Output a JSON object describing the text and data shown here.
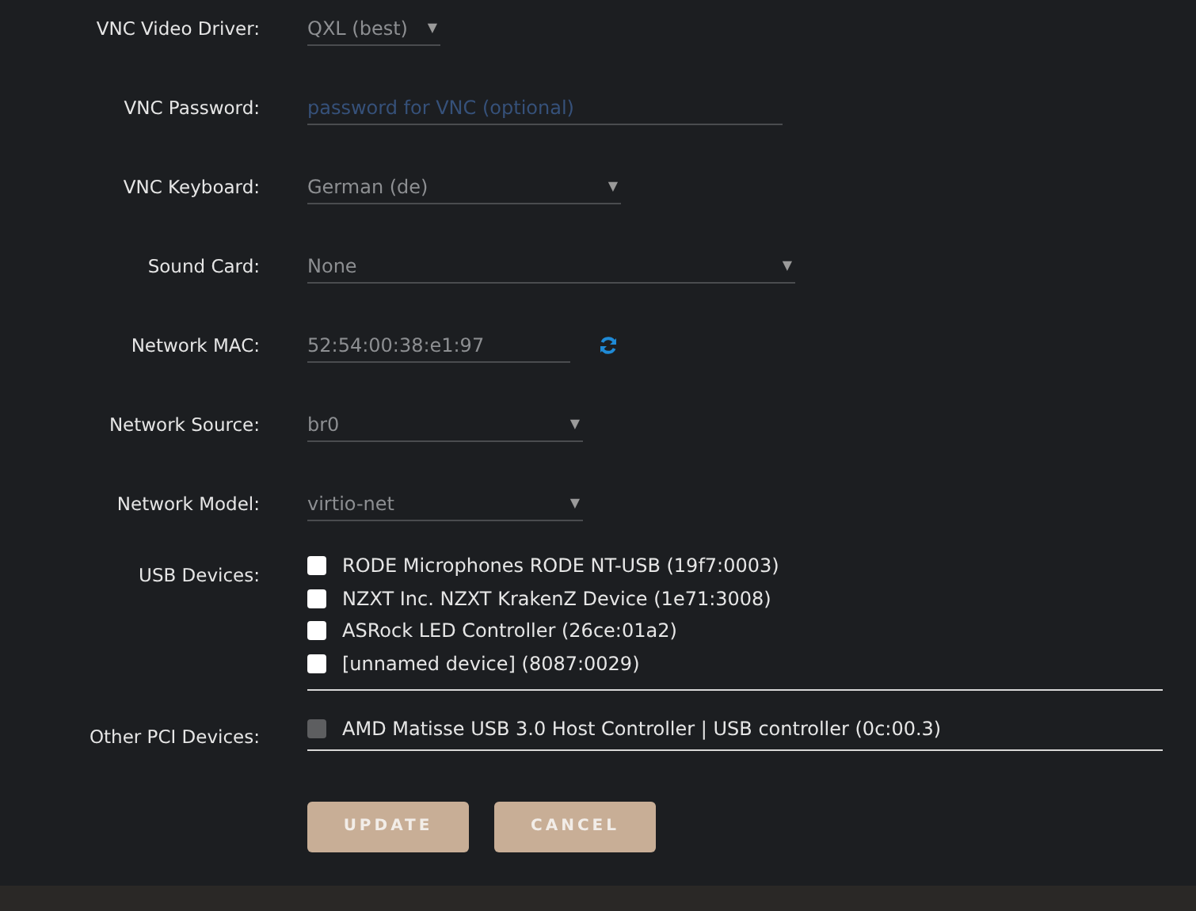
{
  "fields": [
    {
      "kind": "select",
      "label": "VNC Video Driver:",
      "value": "QXL (best)",
      "caret": "▼"
    },
    {
      "kind": "text",
      "label": "VNC Password:",
      "placeholder": "password for VNC (optional)"
    },
    {
      "kind": "select",
      "label": "VNC Keyboard:",
      "value": "German (de)",
      "caret": "▼"
    },
    {
      "kind": "select",
      "label": "Sound Card:",
      "value": "None",
      "caret": "▼"
    },
    {
      "kind": "mac",
      "label": "Network MAC:",
      "value": "52:54:00:38:e1:97"
    },
    {
      "kind": "select",
      "label": "Network Source:",
      "value": "br0",
      "caret": "▼"
    },
    {
      "kind": "select",
      "label": "Network Model:",
      "value": "virtio-net",
      "caret": "▼"
    }
  ],
  "usb": {
    "label": "USB Devices:",
    "items": [
      {
        "label": "RODE Microphones RODE NT-USB (19f7:0003)",
        "checked": false,
        "disabled": false
      },
      {
        "label": "NZXT Inc. NZXT KrakenZ Device (1e71:3008)",
        "checked": false,
        "disabled": false
      },
      {
        "label": "ASRock LED Controller (26ce:01a2)",
        "checked": false,
        "disabled": false
      },
      {
        "label": "[unnamed device] (8087:0029)",
        "checked": false,
        "disabled": false
      }
    ]
  },
  "pci": {
    "label": "Other PCI Devices:",
    "items": [
      {
        "label": "AMD Matisse USB 3.0 Host Controller | USB controller (0c:00.3)",
        "checked": false,
        "disabled": true
      }
    ]
  },
  "buttons": [
    "UPDATE",
    "CANCEL"
  ]
}
